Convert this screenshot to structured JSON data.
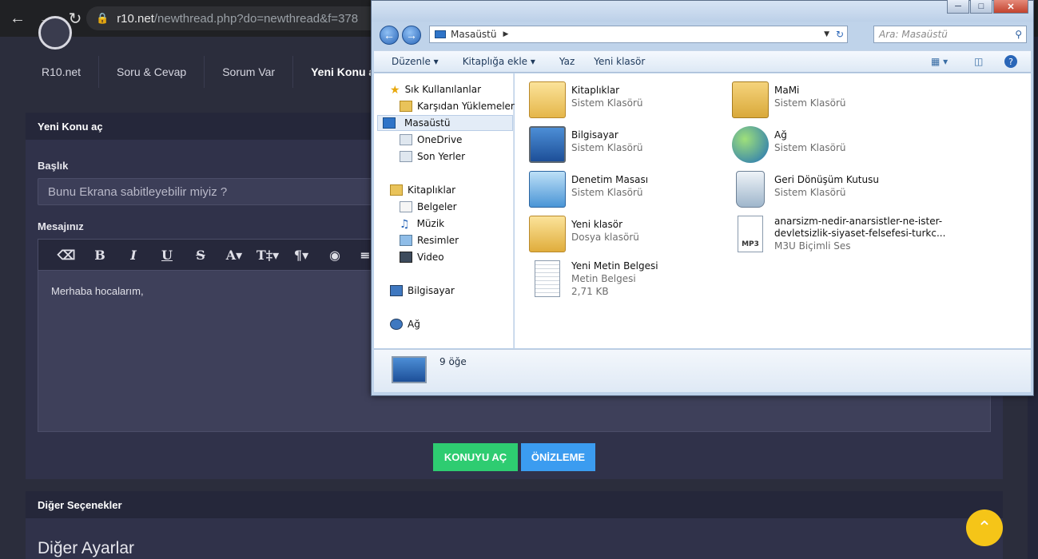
{
  "browser": {
    "url_host": "r10.net",
    "url_path": "/newthread.php?do=newthread&f=378"
  },
  "breadcrumb": [
    "R10.net",
    "Soru & Cevap",
    "Sorum Var",
    "Yeni Konu aç"
  ],
  "form": {
    "panel_title": "Yeni Konu aç",
    "title_label": "Başlık",
    "title_value": "Bunu Ekrana sabitleyebilir miyiz ?",
    "message_label": "Mesajınız",
    "message_text": "Merhaba hocalarım,",
    "submit_label": "KONUYU AÇ",
    "preview_label": "ÖNİZLEME",
    "toolbar": [
      "eraser-icon",
      "B",
      "I",
      "U",
      "S",
      "A▾",
      "T‡▾",
      "¶▾",
      "palette-icon",
      "≡▾"
    ]
  },
  "other": {
    "panel_title": "Diğer Seçenekler",
    "heading": "Diğer Ayarlar"
  },
  "explorer": {
    "address": "Masaüstü",
    "search_placeholder": "Ara: Masaüstü",
    "commands": [
      "Düzenle ▾",
      "Kitaplığa ekle ▾",
      "Yaz",
      "Yeni klasör"
    ],
    "nav": {
      "favorites": "Sık Kullanılanlar",
      "downloads": "Karşıdan Yüklemeler",
      "desktop": "Masaüstü",
      "onedrive": "OneDrive",
      "recent": "Son Yerler",
      "libraries": "Kitaplıklar",
      "documents": "Belgeler",
      "music": "Müzik",
      "pictures": "Resimler",
      "video": "Video",
      "computer": "Bilgisayar",
      "network": "Ağ"
    },
    "items": [
      {
        "name": "Kitaplıklar",
        "type": "Sistem Klasörü"
      },
      {
        "name": "MaMi",
        "type": "Sistem Klasörü"
      },
      {
        "name": "Bilgisayar",
        "type": "Sistem Klasörü"
      },
      {
        "name": "Ağ",
        "type": "Sistem Klasörü"
      },
      {
        "name": "Denetim Masası",
        "type": "Sistem Klasörü"
      },
      {
        "name": "Geri Dönüşüm Kutusu",
        "type": "Sistem Klasörü"
      },
      {
        "name": "Yeni klasör",
        "type": "Dosya klasörü"
      },
      {
        "name": "anarsizm-nedir-anarsistler-ne-ister-",
        "name2": "devletsizlik-siyaset-felsefesi-turkc...",
        "type": "M3U Biçimli Ses"
      },
      {
        "name": "Yeni Metin Belgesi",
        "type": "Metin Belgesi",
        "size": "2,71 KB"
      }
    ],
    "status": "9 öğe"
  }
}
